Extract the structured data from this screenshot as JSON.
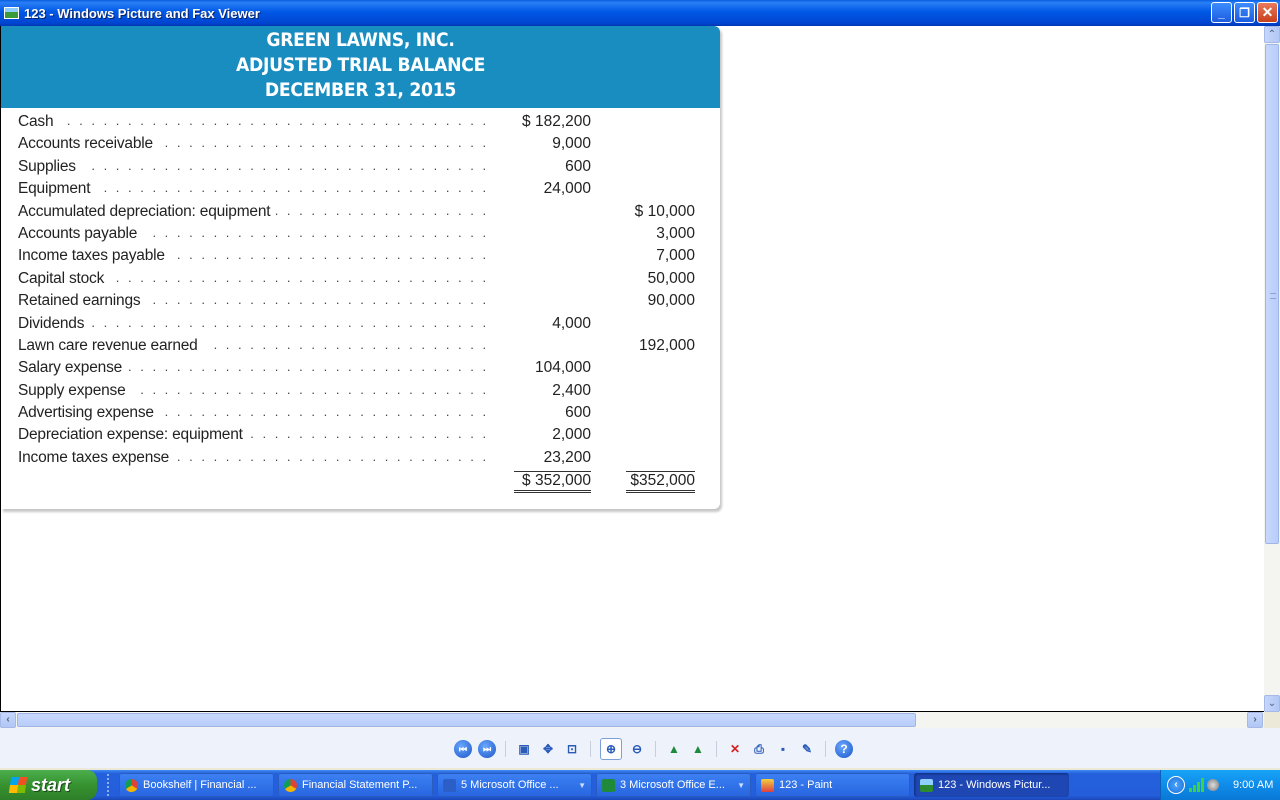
{
  "window": {
    "title": "123 - Windows Picture and Fax Viewer",
    "controls": {
      "minimize": "_",
      "restore": "❐",
      "close": "✕"
    }
  },
  "document": {
    "company": "GREEN LAWNS, INC.",
    "statement": "ADJUSTED TRIAL BALANCE",
    "date": "DECEMBER 31, 2015",
    "header_color": "#1a8dc0",
    "rows": [
      {
        "account": "Cash",
        "debit": "$ 182,200",
        "credit": ""
      },
      {
        "account": "Accounts receivable",
        "debit": "9,000",
        "credit": ""
      },
      {
        "account": "Supplies",
        "debit": "600",
        "credit": ""
      },
      {
        "account": "Equipment",
        "debit": "24,000",
        "credit": ""
      },
      {
        "account": "Accumulated depreciation: equipment",
        "debit": "",
        "credit": "$ 10,000"
      },
      {
        "account": "Accounts payable",
        "debit": "",
        "credit": "3,000"
      },
      {
        "account": "Income taxes payable",
        "debit": "",
        "credit": "7,000"
      },
      {
        "account": "Capital stock",
        "debit": "",
        "credit": "50,000"
      },
      {
        "account": "Retained earnings",
        "debit": "",
        "credit": "90,000"
      },
      {
        "account": "Dividends",
        "debit": "4,000",
        "credit": ""
      },
      {
        "account": "Lawn care revenue earned",
        "debit": "",
        "credit": "192,000"
      },
      {
        "account": "Salary expense",
        "debit": "104,000",
        "credit": ""
      },
      {
        "account": "Supply expense",
        "debit": "2,400",
        "credit": ""
      },
      {
        "account": "Advertising expense",
        "debit": "600",
        "credit": ""
      },
      {
        "account": "Depreciation expense: equipment",
        "debit": "2,000",
        "credit": ""
      },
      {
        "account": "Income taxes expense",
        "debit": "23,200",
        "credit": ""
      }
    ],
    "totals": {
      "debit": "$ 352,000",
      "credit": "$352,000"
    },
    "leader": ". . . . . . . . . . . . . . . . . . . . . . . . . . . . . . . . . . . . . . . . . . . . . . . . . . . . . . . . . . . . . . . ."
  },
  "scrollbars": {
    "up": "⌃",
    "down": "⌄",
    "left": "‹",
    "right": "›"
  },
  "toolbar": {
    "buttons": [
      {
        "name": "previous-image-button",
        "icon": "previous-icon",
        "glyph": "⏮"
      },
      {
        "name": "next-image-button",
        "icon": "next-icon",
        "glyph": "⏭"
      },
      {
        "sep": true
      },
      {
        "name": "best-fit-button",
        "icon": "best-fit-icon",
        "glyph": "▣"
      },
      {
        "name": "actual-size-button",
        "icon": "actual-size-icon",
        "glyph": "✥"
      },
      {
        "name": "slide-show-button",
        "icon": "slideshow-icon",
        "glyph": "⊡"
      },
      {
        "sep": true
      },
      {
        "name": "zoom-in-button",
        "icon": "zoom-in-icon",
        "glyph": "⊕",
        "active": true
      },
      {
        "name": "zoom-out-button",
        "icon": "zoom-out-icon",
        "glyph": "⊖"
      },
      {
        "sep": true
      },
      {
        "name": "rotate-clockwise-button",
        "icon": "rotate-cw-icon",
        "glyph": "▲"
      },
      {
        "name": "rotate-counterclockwise-button",
        "icon": "rotate-ccw-icon",
        "glyph": "▲"
      },
      {
        "sep": true
      },
      {
        "name": "delete-button",
        "icon": "delete-icon",
        "glyph": "✕",
        "color": "#d42020"
      },
      {
        "name": "print-button",
        "icon": "print-icon",
        "glyph": "⎙"
      },
      {
        "name": "save-button",
        "icon": "save-icon",
        "glyph": "▪"
      },
      {
        "name": "edit-button",
        "icon": "edit-image-icon",
        "glyph": "✎"
      },
      {
        "sep": true
      },
      {
        "name": "help-button",
        "icon": "help-icon",
        "glyph": "?"
      }
    ]
  },
  "taskbar": {
    "start_label": "start",
    "tasks": [
      {
        "label": "Bookshelf | Financial ...",
        "icon": "chrome-icon",
        "width": 155,
        "dropdown": false,
        "active": false
      },
      {
        "label": "Financial Statement P...",
        "icon": "chrome-icon",
        "width": 155,
        "dropdown": false,
        "active": false
      },
      {
        "label": "5 Microsoft Office ...",
        "icon": "word-icon",
        "width": 155,
        "dropdown": true,
        "active": false
      },
      {
        "label": "3 Microsoft Office E...",
        "icon": "excel-icon",
        "width": 155,
        "dropdown": true,
        "active": false
      },
      {
        "label": "123 - Paint",
        "icon": "paint-icon",
        "width": 155,
        "dropdown": false,
        "active": false
      },
      {
        "label": "123 - Windows Pictur...",
        "icon": "picture-viewer-icon",
        "width": 155,
        "dropdown": false,
        "active": true
      }
    ],
    "clock": "9:00 AM"
  }
}
